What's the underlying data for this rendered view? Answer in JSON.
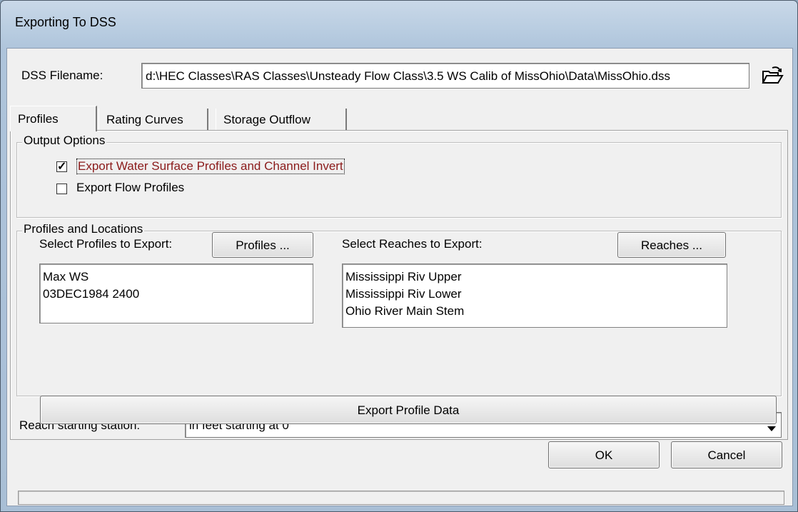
{
  "window": {
    "title": "Exporting To DSS"
  },
  "file": {
    "label": "DSS Filename:",
    "value": "d:\\HEC Classes\\RAS Classes\\Unsteady Flow Class\\3.5 WS Calib of MissOhio\\Data\\MissOhio.dss",
    "browse_icon": "open-folder-icon"
  },
  "tabs": [
    {
      "label": "Profiles",
      "active": true
    },
    {
      "label": "Rating Curves",
      "active": false
    },
    {
      "label": "Storage Outflow",
      "active": false
    }
  ],
  "output_options": {
    "title": "Output Options",
    "wse": {
      "label": "Export Water Surface Profiles and Channel Invert",
      "checked": true,
      "color": "#8b1a1a"
    },
    "flow": {
      "label": "Export Flow Profiles",
      "checked": false
    }
  },
  "profiles_locations": {
    "title": "Profiles and Locations",
    "profiles_label": "Select Profiles to Export:",
    "profiles_button": "Profiles ...",
    "profiles": [
      "Max WS",
      "03DEC1984 2400"
    ],
    "reaches_label": "Select Reaches to Export:",
    "reaches_button": "Reaches ...",
    "reaches": [
      "Mississippi Riv Upper",
      "Mississippi Riv Lower",
      "Ohio River Main Stem"
    ]
  },
  "station": {
    "label": "Reach starting station:",
    "value": "in feet starting at 0"
  },
  "export_button": "Export Profile Data",
  "ok_button": "OK",
  "cancel_button": "Cancel",
  "status": ""
}
